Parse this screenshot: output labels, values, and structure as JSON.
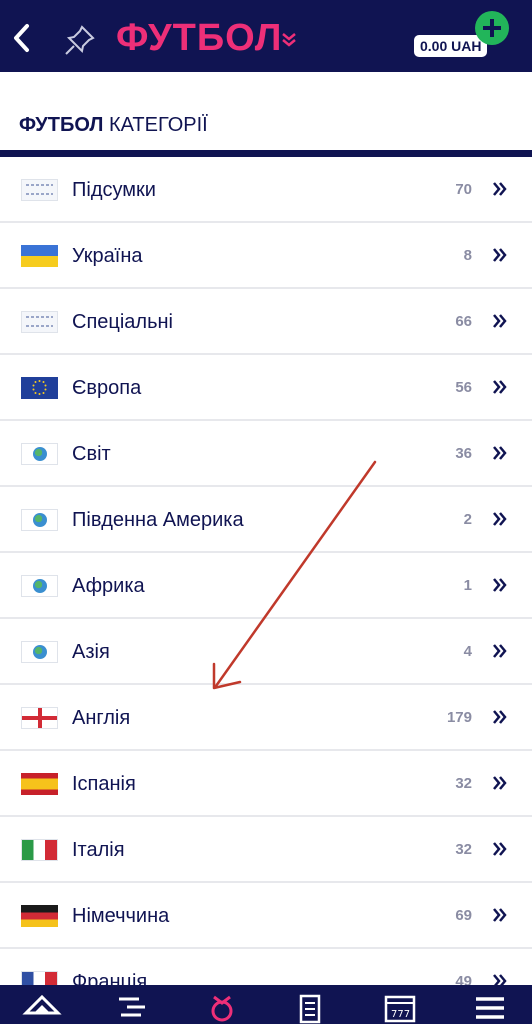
{
  "header": {
    "title": "ФУТБОЛ",
    "balance": "0.00 UAH"
  },
  "section": {
    "title_bold": "ФУТБОЛ",
    "title_rest": "КАТЕГОРІЇ"
  },
  "categories": [
    {
      "name": "Підсумки",
      "count": "70",
      "flag": "summary"
    },
    {
      "name": "Україна",
      "count": "8",
      "flag": "ukraine"
    },
    {
      "name": "Спеціальні",
      "count": "66",
      "flag": "summary"
    },
    {
      "name": "Європа",
      "count": "56",
      "flag": "eu"
    },
    {
      "name": "Світ",
      "count": "36",
      "flag": "world"
    },
    {
      "name": "Південна Америка",
      "count": "2",
      "flag": "world"
    },
    {
      "name": "Африка",
      "count": "1",
      "flag": "world"
    },
    {
      "name": "Азія",
      "count": "4",
      "flag": "world"
    },
    {
      "name": "Англія",
      "count": "179",
      "flag": "england"
    },
    {
      "name": "Іспанія",
      "count": "32",
      "flag": "spain"
    },
    {
      "name": "Італія",
      "count": "32",
      "flag": "italy"
    },
    {
      "name": "Німеччина",
      "count": "69",
      "flag": "germany"
    },
    {
      "name": "Франція",
      "count": "49",
      "flag": "france"
    }
  ],
  "icons": {
    "back": "chevron-left-icon",
    "pin": "pin-icon",
    "title_dropdown": "double-chevron-down-icon",
    "add_funds": "plus-icon",
    "row_chevron": "double-chevron-right-icon"
  },
  "colors": {
    "header_bg": "#101452",
    "accent_pink": "#ee2f78",
    "add_green": "#22b55a",
    "annotation_arrow": "#c0392b"
  }
}
